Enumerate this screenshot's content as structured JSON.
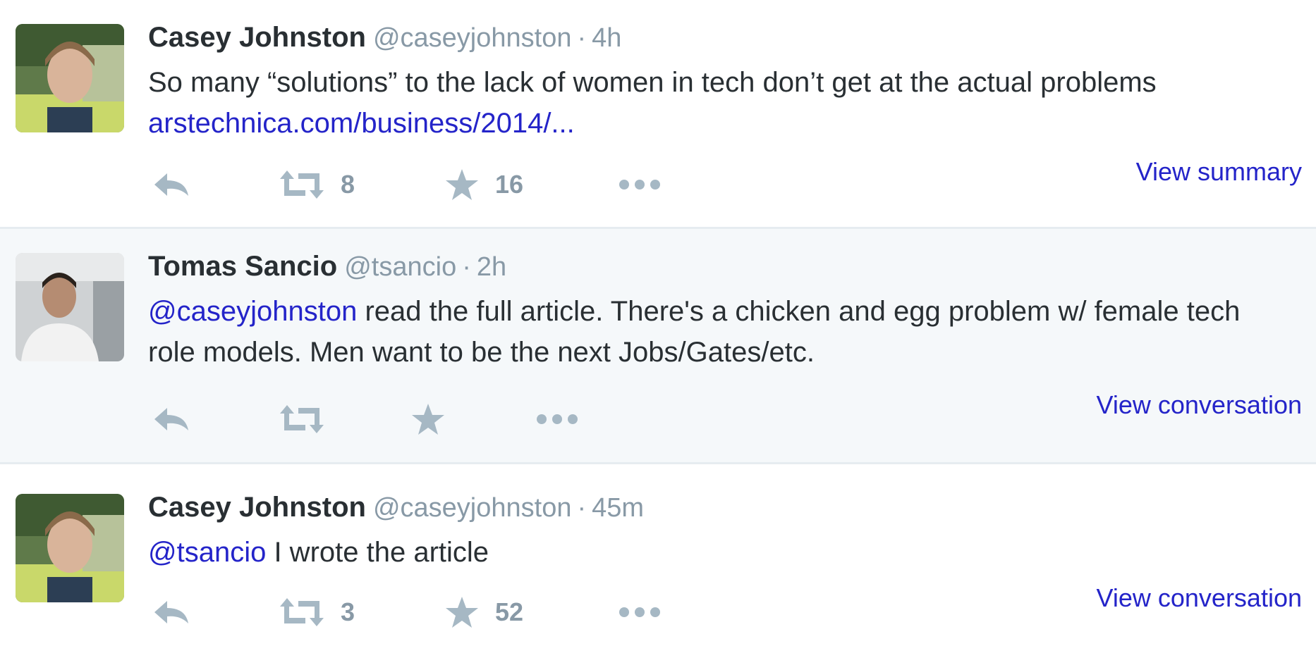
{
  "tweets": [
    {
      "name": "Casey Johnston",
      "handle": "@caseyjohnston",
      "separator": "·",
      "time": "4h",
      "text_before": "So many “solutions” to the lack of women in tech don’t get at the actual problems ",
      "link": "arstechnica.com/business/2014/...",
      "retweet_count": "8",
      "favorite_count": "16",
      "view_link": "View summary",
      "highlighted": false
    },
    {
      "name": "Tomas Sancio",
      "handle": "@tsancio",
      "separator": "·",
      "time": "2h",
      "mention": "@caseyjohnston",
      "text_after": " read the full article. There's a chicken and egg problem w/ female tech role models. Men want to be the next Jobs/Gates/etc.",
      "retweet_count": "",
      "favorite_count": "",
      "view_link": "View conversation",
      "highlighted": true
    },
    {
      "name": "Casey Johnston",
      "handle": "@caseyjohnston",
      "separator": "·",
      "time": "45m",
      "mention": "@tsancio",
      "text_after": " I wrote the article",
      "retweet_count": "3",
      "favorite_count": "52",
      "view_link": "View conversation",
      "highlighted": false
    }
  ],
  "icons": {
    "reply": "reply-icon",
    "retweet": "retweet-icon",
    "favorite": "star-icon",
    "more": "more-icon"
  },
  "colors": {
    "link": "#2424c9",
    "name": "#292f33",
    "meta": "#8899a6",
    "icon": "#a6b8c4",
    "highlight_bg": "#f5f8fa",
    "divider": "#e6ecf0"
  }
}
